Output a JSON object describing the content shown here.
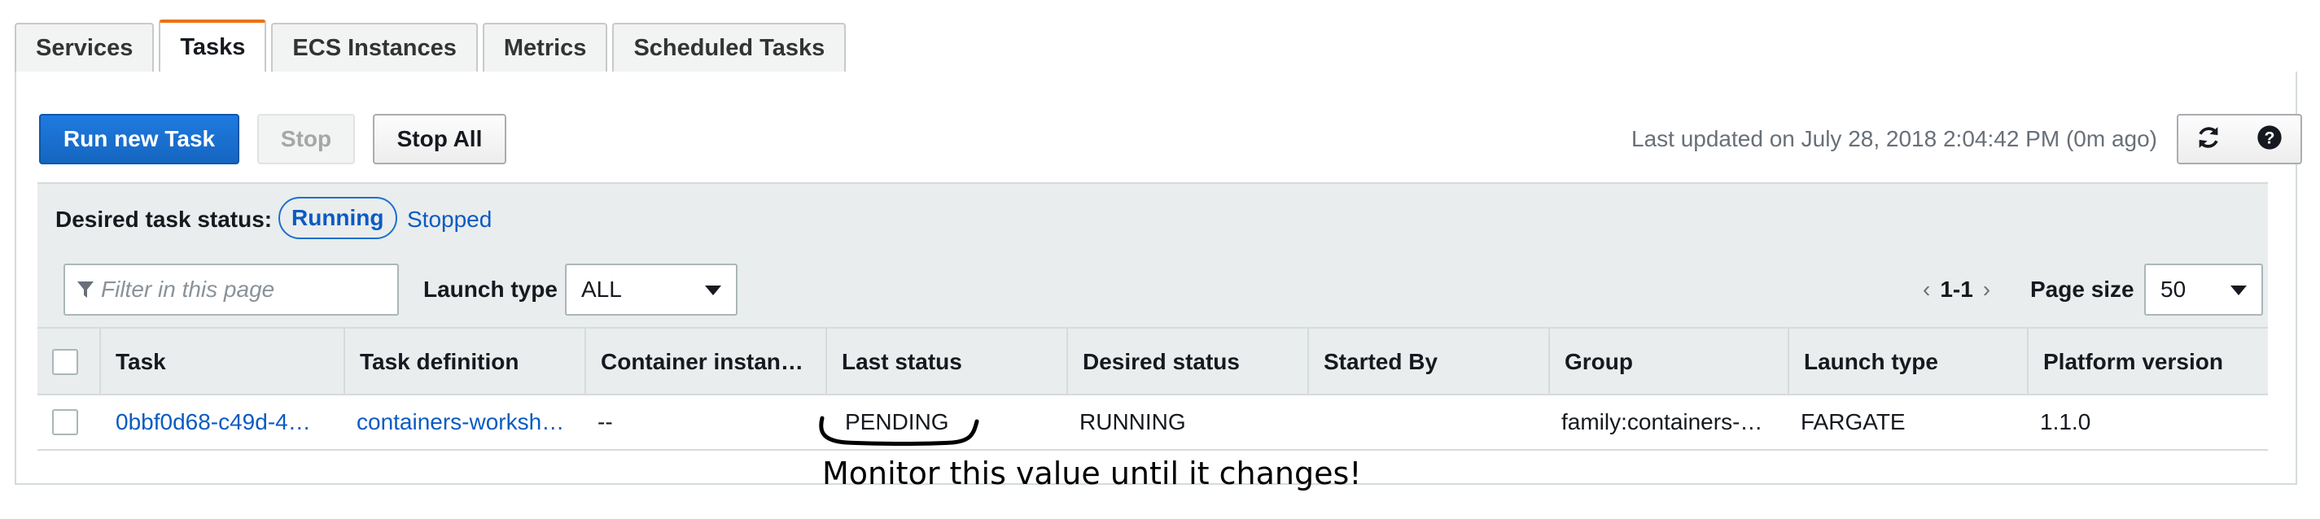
{
  "tabs": [
    {
      "label": "Services",
      "active": false
    },
    {
      "label": "Tasks",
      "active": true
    },
    {
      "label": "ECS Instances",
      "active": false
    },
    {
      "label": "Metrics",
      "active": false
    },
    {
      "label": "Scheduled Tasks",
      "active": false
    }
  ],
  "toolbar": {
    "run_new_task": "Run new Task",
    "stop": "Stop",
    "stop_all": "Stop All",
    "last_updated": "Last updated on July 28, 2018 2:04:42 PM (0m ago)",
    "refresh_icon": "refresh-icon",
    "help_icon": "help-icon"
  },
  "filters": {
    "desired_status_label": "Desired task status:",
    "running": "Running",
    "stopped": "Stopped",
    "search_placeholder": "Filter in this page",
    "launch_type_label": "Launch type",
    "launch_type_value": "ALL",
    "page_range": "1-1",
    "page_size_label": "Page size",
    "page_size_value": "50"
  },
  "table": {
    "columns": [
      "Task",
      "Task definition",
      "Container instan…",
      "Last status",
      "Desired status",
      "Started By",
      "Group",
      "Launch type",
      "Platform version"
    ],
    "rows": [
      {
        "task": "0bbf0d68-c49d-4…",
        "task_definition": "containers-worksh…",
        "container_instance": "--",
        "last_status": "PENDING",
        "desired_status": "RUNNING",
        "started_by": "",
        "group": "family:containers-…",
        "launch_type": "FARGATE",
        "platform_version": "1.1.0"
      }
    ]
  },
  "annotation": "Monitor this value until it changes!",
  "colors": {
    "primary": "#1566c0",
    "tab_accent": "#ec7211",
    "link": "#0a5bc2",
    "header_bg": "#eaeded"
  }
}
